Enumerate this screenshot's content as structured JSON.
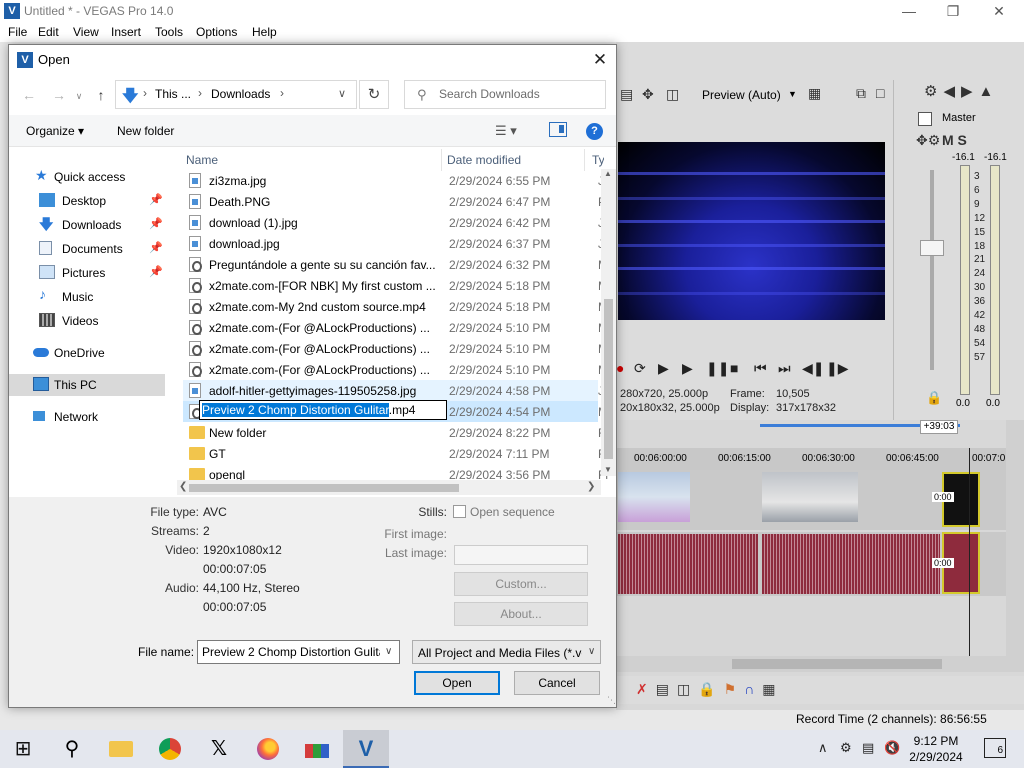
{
  "vegas": {
    "title": "Untitled * - VEGAS Pro 14.0",
    "menu": [
      "File",
      "Edit",
      "View",
      "Insert",
      "Tools",
      "Options",
      "Help"
    ],
    "preview_mode": "Preview (Auto)",
    "project_info": "280x720, 25.000p",
    "preview_info": "20x180x32, 25.000p",
    "frame_label": "Frame:",
    "frame_value": "10,505",
    "display_label": "Display:",
    "display_value": "317x178x32",
    "master_label": "Master",
    "master_ms": "M S",
    "db_left": "-16.1",
    "db_right": "-16.1",
    "meter_scale": [
      "3",
      "6",
      "9",
      "12",
      "15",
      "18",
      "21",
      "24",
      "30",
      "36",
      "42",
      "48",
      "54",
      "57"
    ],
    "meter_zero_left": "0.0",
    "meter_zero_right": "0.0",
    "ruler_marks": [
      "00:06:00:00",
      "00:06:15:00",
      "00:06:30:00",
      "00:06:45:00",
      "00:07:0"
    ],
    "cursor_time": "+39:03",
    "clip_time_top": "0:00",
    "clip_time_bottom": "0:00",
    "record_time": "Record Time (2 channels): 86:56:55"
  },
  "dialog": {
    "title": "Open",
    "breadcrumb": [
      "This ...",
      "Downloads"
    ],
    "search_placeholder": "Search Downloads",
    "organize_label": "Organize ▾",
    "new_folder_label": "New folder",
    "nav_items": [
      {
        "label": "Quick access",
        "pinned": false
      },
      {
        "label": "Desktop",
        "pinned": true
      },
      {
        "label": "Downloads",
        "pinned": true
      },
      {
        "label": "Documents",
        "pinned": true
      },
      {
        "label": "Pictures",
        "pinned": true
      },
      {
        "label": "Music",
        "pinned": false
      },
      {
        "label": "Videos",
        "pinned": false
      },
      {
        "label": "OneDrive",
        "pinned": false
      },
      {
        "label": "This PC",
        "pinned": false
      },
      {
        "label": "Network",
        "pinned": false
      }
    ],
    "columns": {
      "name": "Name",
      "date": "Date modified",
      "type": "Ty"
    },
    "files": [
      {
        "name": "zi3zma.jpg",
        "date": "2/29/2024 6:55 PM",
        "type": "JP",
        "icon": "img"
      },
      {
        "name": "Death.PNG",
        "date": "2/29/2024 6:47 PM",
        "type": "PI",
        "icon": "img"
      },
      {
        "name": "download (1).jpg",
        "date": "2/29/2024 6:42 PM",
        "type": "JP",
        "icon": "img"
      },
      {
        "name": "download.jpg",
        "date": "2/29/2024 6:37 PM",
        "type": "JP",
        "icon": "img"
      },
      {
        "name": "Preguntándole a gente su su canción fav...",
        "date": "2/29/2024 6:32 PM",
        "type": "M",
        "icon": "vid"
      },
      {
        "name": "x2mate.com-[FOR NBK] My first custom ...",
        "date": "2/29/2024 5:18 PM",
        "type": "M",
        "icon": "vid"
      },
      {
        "name": "x2mate.com-My 2nd custom source.mp4",
        "date": "2/29/2024 5:18 PM",
        "type": "M",
        "icon": "vid"
      },
      {
        "name": "x2mate.com-(For @ALockProductions) ...",
        "date": "2/29/2024 5:10 PM",
        "type": "M",
        "icon": "vid"
      },
      {
        "name": "x2mate.com-(For @ALockProductions) ...",
        "date": "2/29/2024 5:10 PM",
        "type": "M",
        "icon": "vid"
      },
      {
        "name": "x2mate.com-(For @ALockProductions) ...",
        "date": "2/29/2024 5:10 PM",
        "type": "M",
        "icon": "vid"
      },
      {
        "name": "adolf-hitler-gettyimages-119505258.jpg",
        "date": "2/29/2024 4:58 PM",
        "type": "JP",
        "icon": "img"
      },
      {
        "name": "Preview 2 Chomp Distortion Gulitar.mp4",
        "date": "2/29/2024 4:54 PM",
        "type": "M",
        "icon": "vid"
      },
      {
        "name": "New folder",
        "date": "2/29/2024 8:22 PM",
        "type": "Fi",
        "icon": "folder"
      },
      {
        "name": "GT",
        "date": "2/29/2024 7:11 PM",
        "type": "Fi",
        "icon": "folder"
      },
      {
        "name": "opengl",
        "date": "2/29/2024 3:56 PM",
        "type": "Fi",
        "icon": "folder"
      }
    ],
    "rename": {
      "selected": "Preview 2 Chomp Distortion Gulitar",
      "rest": ".mp4"
    },
    "props": {
      "file_type_label": "File type:",
      "file_type": "AVC",
      "streams_label": "Streams:",
      "streams": "2",
      "video_label": "Video:",
      "video_res": "1920x1080x12",
      "video_dur": "00:00:07:05",
      "audio_label": "Audio:",
      "audio_info": "44,100 Hz, Stereo",
      "audio_dur": "00:00:07:05",
      "stills_label": "Stills:",
      "open_sequence": "Open sequence",
      "first_image_label": "First image:",
      "last_image_label": "Last image:",
      "custom_label": "Custom...",
      "about_label": "About..."
    },
    "file_name_label": "File name:",
    "file_name_value": "Preview 2 Chomp Distortion Gulitar.mp4",
    "file_type_filter": "All Project and Media Files (*.ve",
    "open_label": "Open",
    "cancel_label": "Cancel"
  },
  "taskbar": {
    "time": "9:12 PM",
    "date": "2/29/2024",
    "notifications": "6"
  },
  "colors": {
    "accent": "#0078d7",
    "vegas_blue": "#1e5fa8",
    "audio_wave": "#8e2b3d"
  }
}
